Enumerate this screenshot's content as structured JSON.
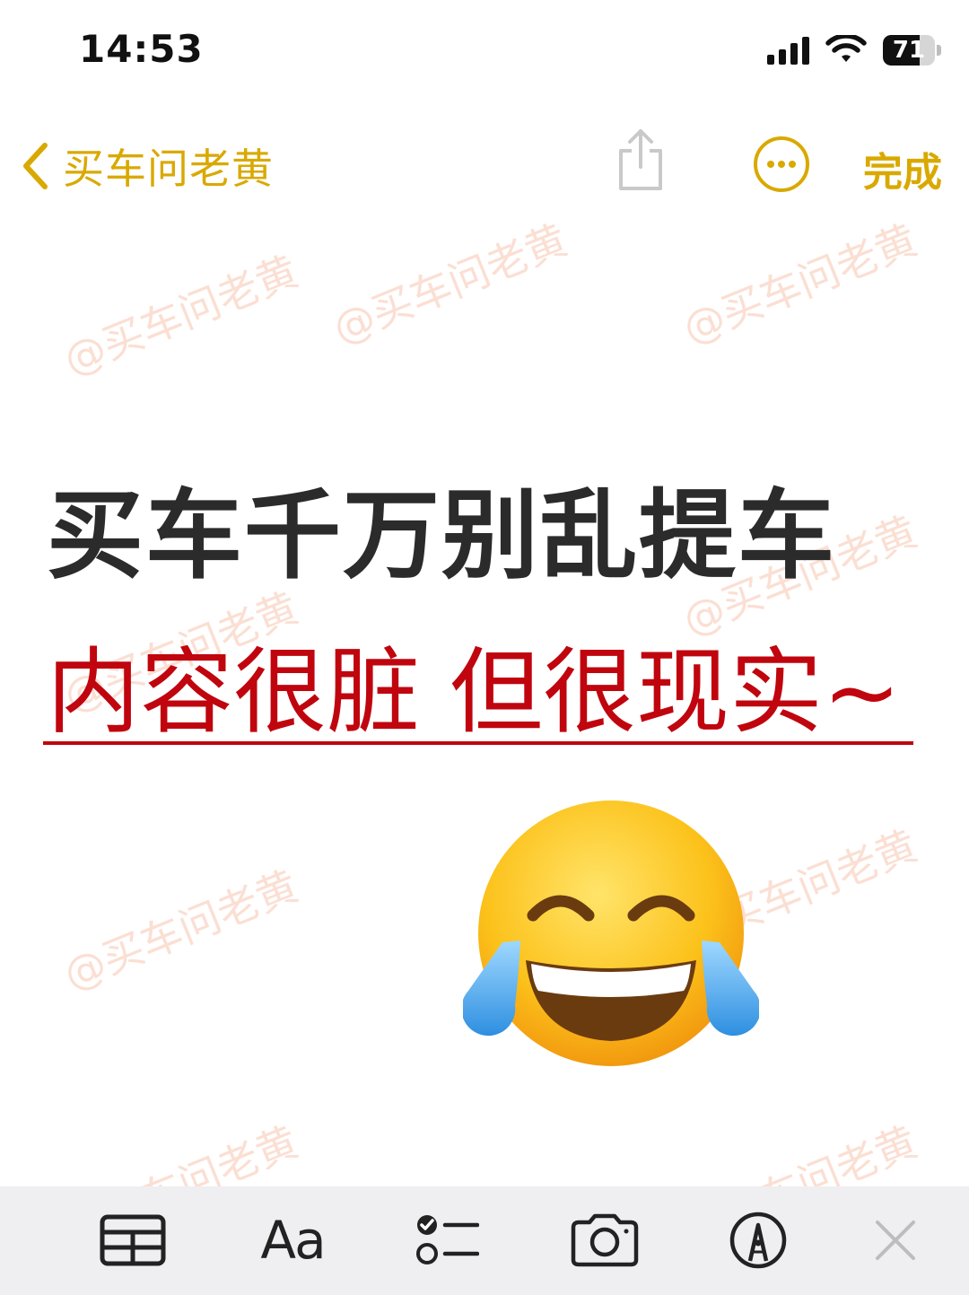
{
  "status_bar": {
    "time": "14:53",
    "battery_level": "71",
    "battery_percent": 71,
    "signal_icon": "cellular-signal-icon",
    "wifi_icon": "wifi-icon"
  },
  "nav": {
    "back_label": "买车问老黄",
    "back_icon": "chevron-left-icon",
    "share_icon": "share-icon",
    "more_icon": "ellipsis-circle-icon",
    "done_label": "完成",
    "accent_color": "#d9a900"
  },
  "note": {
    "title": "买车千万别乱提车",
    "subtitle": "内容很脏 但很现实~",
    "subtitle_color": "#c0050e",
    "emoji": "face-with-tears-of-joy"
  },
  "watermark": {
    "text": "@买车问老黄"
  },
  "toolbar": {
    "table_icon": "table-icon",
    "format_label": "Aa",
    "checklist_icon": "checklist-icon",
    "camera_icon": "camera-icon",
    "markup_icon": "pen-tip-circle-icon",
    "close_icon": "close-icon"
  }
}
